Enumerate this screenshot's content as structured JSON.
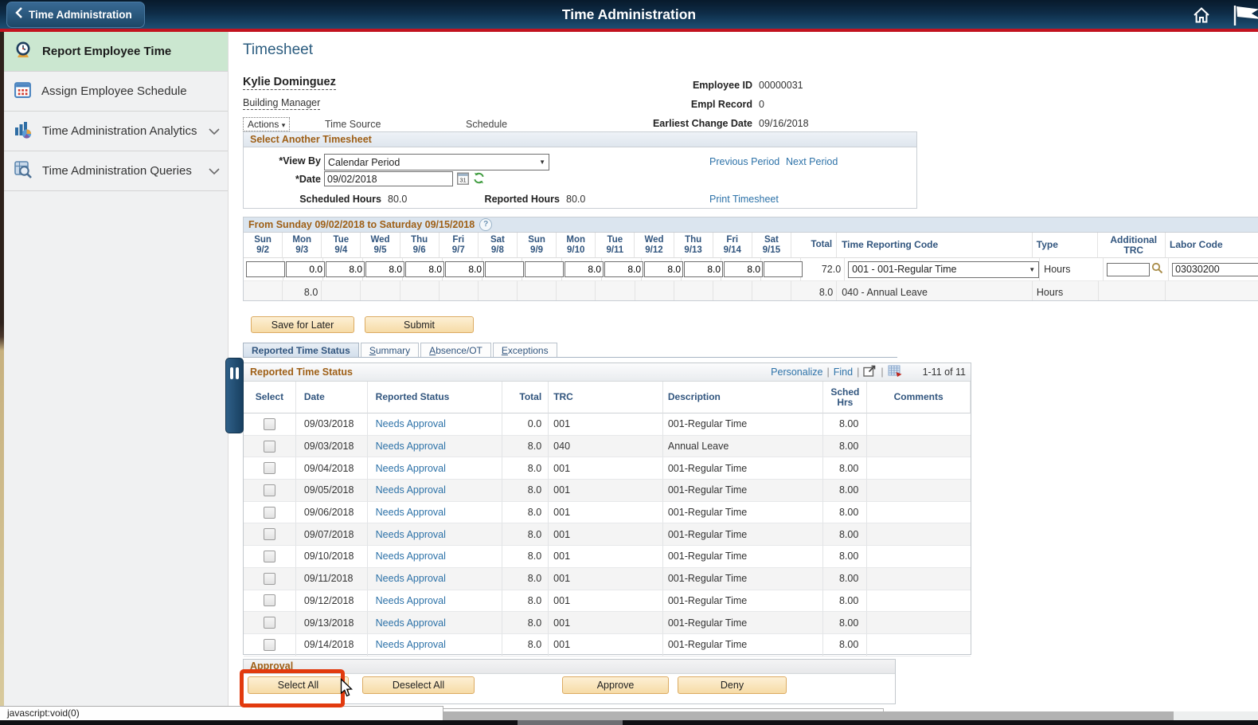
{
  "header": {
    "back_button": "Time Administration",
    "title": "Time Administration",
    "home_icon": "home-icon",
    "flag_icon": "flag-icon"
  },
  "sidebar": {
    "items": [
      {
        "label": "Report Employee Time",
        "icon": "clock-icon",
        "active": true,
        "has_chevron": false
      },
      {
        "label": "Assign Employee Schedule",
        "icon": "calendar-icon",
        "active": false,
        "has_chevron": false
      },
      {
        "label": "Time Administration Analytics",
        "icon": "bar-chart-icon",
        "active": false,
        "has_chevron": true
      },
      {
        "label": "Time Administration Queries",
        "icon": "query-search-icon",
        "active": false,
        "has_chevron": true
      }
    ]
  },
  "page": {
    "title": "Timesheet",
    "employee_name": "Kylie Dominguez",
    "employee_role": "Building Manager",
    "actions_label": "Actions",
    "time_source_label": "Time Source",
    "schedule_label": "Schedule",
    "info": [
      {
        "label": "Employee ID",
        "value": "00000031"
      },
      {
        "label": "Empl Record",
        "value": "0"
      },
      {
        "label": "Earliest Change Date",
        "value": "09/16/2018"
      }
    ]
  },
  "select_timesheet": {
    "title": "Select Another Timesheet",
    "view_by_label": "*View By",
    "view_by_value": "Calendar Period",
    "date_label": "*Date",
    "date_value": "09/02/2018",
    "prev_link": "Previous Period",
    "next_link": "Next Period",
    "scheduled_hours_label": "Scheduled Hours",
    "scheduled_hours": "80.0",
    "reported_hours_label": "Reported Hours",
    "reported_hours": "80.0",
    "print_link": "Print Timesheet"
  },
  "grid": {
    "title": "From Sunday 09/02/2018 to Saturday 09/15/2018",
    "days": [
      {
        "day": "Sun",
        "date": "9/2"
      },
      {
        "day": "Mon",
        "date": "9/3"
      },
      {
        "day": "Tue",
        "date": "9/4"
      },
      {
        "day": "Wed",
        "date": "9/5"
      },
      {
        "day": "Thu",
        "date": "9/6"
      },
      {
        "day": "Fri",
        "date": "9/7"
      },
      {
        "day": "Sat",
        "date": "9/8"
      },
      {
        "day": "Sun",
        "date": "9/9"
      },
      {
        "day": "Mon",
        "date": "9/10"
      },
      {
        "day": "Tue",
        "date": "9/11"
      },
      {
        "day": "Wed",
        "date": "9/12"
      },
      {
        "day": "Thu",
        "date": "9/13"
      },
      {
        "day": "Fri",
        "date": "9/14"
      },
      {
        "day": "Sat",
        "date": "9/15"
      }
    ],
    "columns": {
      "total": "Total",
      "trc": "Time Reporting Code",
      "type": "Type",
      "additional_trc": "Additional TRC",
      "labor_code": "Labor Code"
    },
    "rows": [
      {
        "editable": true,
        "values": [
          "",
          "0.0",
          "8.0",
          "8.0",
          "8.0",
          "8.0",
          "",
          "",
          "8.0",
          "8.0",
          "8.0",
          "8.0",
          "8.0",
          ""
        ],
        "total": "72.0",
        "trc": "001 - 001-Regular Time",
        "trc_is_dropdown": true,
        "type": "Hours",
        "additional_trc": "",
        "labor_code": "03030200"
      },
      {
        "editable": false,
        "values": [
          "",
          "8.0",
          "",
          "",
          "",
          "",
          "",
          "",
          "",
          "",
          "",
          "",
          "",
          ""
        ],
        "total": "8.0",
        "trc": "040 - Annual Leave",
        "trc_is_dropdown": false,
        "type": "Hours",
        "additional_trc": "",
        "labor_code": ""
      }
    ]
  },
  "buttons": {
    "save": "Save for Later",
    "submit": "Submit"
  },
  "tabs": [
    {
      "label": "Reported Time Status",
      "active": true
    },
    {
      "label": "Summary",
      "active": false
    },
    {
      "label": "Absence/OT",
      "active": false
    },
    {
      "label": "Exceptions",
      "active": false
    }
  ],
  "reported": {
    "title": "Reported Time Status",
    "personalize": "Personalize",
    "find": "Find",
    "view_all_icon": "view-all-icon",
    "download_icon": "download-grid-icon",
    "range": "1-11 of 11",
    "columns": [
      "Select",
      "Date",
      "Reported Status",
      "Total",
      "TRC",
      "Description",
      "Sched Hrs",
      "Comments"
    ],
    "rows": [
      {
        "date": "09/03/2018",
        "status": "Needs Approval",
        "total": "0.0",
        "trc": "001",
        "desc": "001-Regular Time",
        "sched": "8.00",
        "comments": ""
      },
      {
        "date": "09/03/2018",
        "status": "Needs Approval",
        "total": "8.0",
        "trc": "040",
        "desc": "Annual Leave",
        "sched": "8.00",
        "comments": ""
      },
      {
        "date": "09/04/2018",
        "status": "Needs Approval",
        "total": "8.0",
        "trc": "001",
        "desc": "001-Regular Time",
        "sched": "8.00",
        "comments": ""
      },
      {
        "date": "09/05/2018",
        "status": "Needs Approval",
        "total": "8.0",
        "trc": "001",
        "desc": "001-Regular Time",
        "sched": "8.00",
        "comments": ""
      },
      {
        "date": "09/06/2018",
        "status": "Needs Approval",
        "total": "8.0",
        "trc": "001",
        "desc": "001-Regular Time",
        "sched": "8.00",
        "comments": ""
      },
      {
        "date": "09/07/2018",
        "status": "Needs Approval",
        "total": "8.0",
        "trc": "001",
        "desc": "001-Regular Time",
        "sched": "8.00",
        "comments": ""
      },
      {
        "date": "09/10/2018",
        "status": "Needs Approval",
        "total": "8.0",
        "trc": "001",
        "desc": "001-Regular Time",
        "sched": "8.00",
        "comments": ""
      },
      {
        "date": "09/11/2018",
        "status": "Needs Approval",
        "total": "8.0",
        "trc": "001",
        "desc": "001-Regular Time",
        "sched": "8.00",
        "comments": ""
      },
      {
        "date": "09/12/2018",
        "status": "Needs Approval",
        "total": "8.0",
        "trc": "001",
        "desc": "001-Regular Time",
        "sched": "8.00",
        "comments": ""
      },
      {
        "date": "09/13/2018",
        "status": "Needs Approval",
        "total": "8.0",
        "trc": "001",
        "desc": "001-Regular Time",
        "sched": "8.00",
        "comments": ""
      },
      {
        "date": "09/14/2018",
        "status": "Needs Approval",
        "total": "8.0",
        "trc": "001",
        "desc": "001-Regular Time",
        "sched": "8.00",
        "comments": ""
      }
    ]
  },
  "approval": {
    "title": "Approval",
    "buttons": [
      "Select All",
      "Deselect All",
      "Approve",
      "Deny"
    ],
    "highlighted_button": "Select All"
  },
  "status_bar": {
    "text": "javascript:void(0)"
  },
  "colors": {
    "header_top": "#081a2b",
    "header_bottom": "#1c4f74",
    "accent_red_line": "#c2131f",
    "active_sidebar_green": "#cbe7d0",
    "section_title_brown": "#9e5f16",
    "link_blue": "#2d72a8",
    "column_header_navy": "#31557e",
    "button_tan": "#f6dba6",
    "annotation_red": "#e23a0e"
  }
}
